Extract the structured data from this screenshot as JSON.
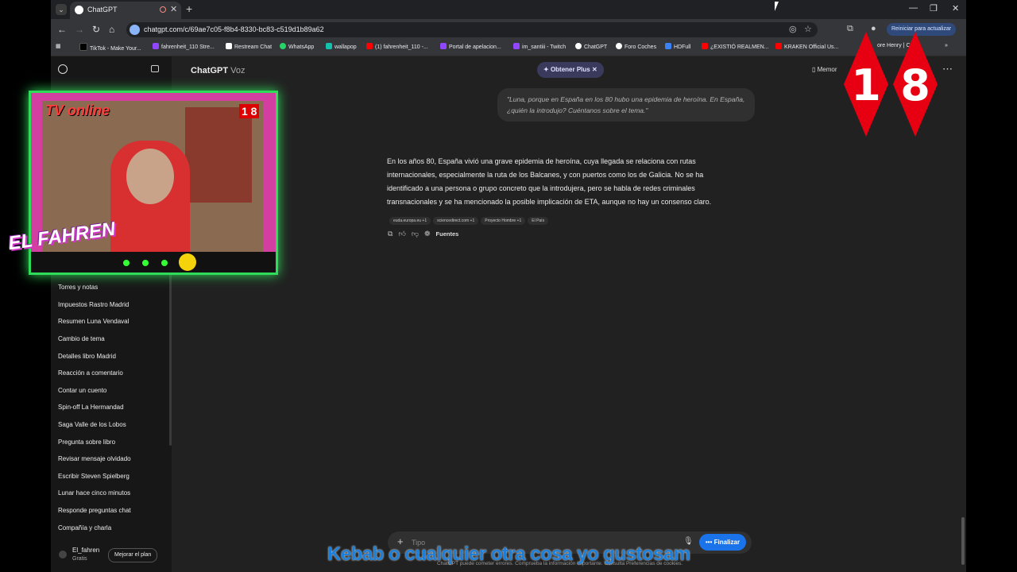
{
  "browser": {
    "tab_title": "ChatGPT",
    "url": "chatgpt.com/c/69ae7c05-f8b4-8330-bc83-c519d1b89a62",
    "update_label": "Reiniciar para actualizar",
    "bookmarks": [
      "TikTok - Make Your...",
      "fahrenheit_110 Stre...",
      "Restream Chat",
      "WhatsApp",
      "wallapop",
      "(1) fahrenheit_110 -...",
      "Portal de apelacion...",
      "im_santiii - Twitch",
      "ChatGPT",
      "Foro Coches",
      "HDFull",
      "¿EXISTIÓ REALMEN...",
      "KRAKEN Official Us...",
      "ore Henry | C"
    ]
  },
  "app": {
    "model_name": "ChatGPT",
    "model_mode": "Voz",
    "plus_label": "Obtener Plus",
    "memory_label": "Memor"
  },
  "sidebar": {
    "chats": [
      "Torres y notas",
      "Impuestos Rastro Madrid",
      "Resumen Luna Vendaval",
      "Cambio de tema",
      "Detalles libro Madrid",
      "Reacción a comentario",
      "Contar un cuento",
      "Spin-off La Hermandad",
      "Saga Valle de los Lobos",
      "Pregunta sobre libro",
      "Revisar mensaje olvidado",
      "Escribir Steven Spielberg",
      "Lunar hace cinco minutos",
      "Responde preguntas chat",
      "Compañía y charla"
    ],
    "user_name": "El_fahren",
    "user_plan": "Gratis",
    "upgrade_label": "Mejorar el plan"
  },
  "conversation": {
    "user_message": "\"Luna, porque en España en los 80 hubo una epidemia de heroína. En España, ¿quién la introdujo? Cuéntanos sobre el tema.\"",
    "assistant_message": "En los años 80, España vivió una grave epidemia de heroína, cuya llegada se relaciona con rutas internacionales, especialmente la ruta de los Balcanes, y con puertos como los de Galicia. No se ha identificado a una persona o grupo concreto que la introdujera, pero se habla de redes criminales transnacionales y se ha mencionado la posible implicación de ETA, aunque no hay un consenso claro.",
    "sources": [
      "euda.europa.eu +1",
      "sciencedirect.com +1",
      "Proyecto Hombre +1",
      "El País"
    ],
    "sources_label": "Fuentes"
  },
  "composer": {
    "placeholder": "Tipo",
    "finish_label": "Finalizar",
    "disclaimer": "ChatGPT puede cometer errores. Comprueba la información importante. Consulta Preferencias de cookies."
  },
  "overlay": {
    "cam_brand": "TV online",
    "badge_small": "1 8",
    "fahren_logo": "EL FAHREN",
    "badge_digit_1": "1",
    "badge_digit_2": "8",
    "subtitle": "Kebab o cualquier otra cosa yo gustosam"
  },
  "colors": {
    "accent": "#1a73e8",
    "cam_border": "#2fdc5a",
    "badge": "#e60012"
  }
}
